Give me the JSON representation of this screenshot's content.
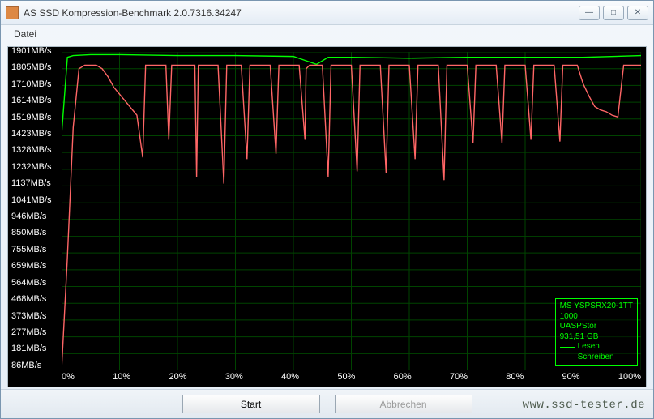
{
  "window": {
    "title": "AS SSD Kompression-Benchmark 2.0.7316.34247",
    "min_label": "—",
    "max_label": "□",
    "close_label": "✕"
  },
  "menu": {
    "file": "Datei"
  },
  "buttons": {
    "start": "Start",
    "abort": "Abbrechen"
  },
  "watermark": "www.ssd-tester.de",
  "device": {
    "line1": "MS YSPSRX20-1TT",
    "line2": "1000",
    "line3": "UASPStor",
    "line4": "931,51 GB"
  },
  "legend": {
    "read": "Lesen",
    "write": "Schreiben"
  },
  "chart_data": {
    "type": "line",
    "xlabel": "",
    "ylabel": "",
    "x_unit": "%",
    "y_unit": "MB/s",
    "xlim": [
      0,
      100
    ],
    "ylim": [
      86,
      1901
    ],
    "x_ticks": [
      0,
      10,
      20,
      30,
      40,
      50,
      60,
      70,
      80,
      90,
      100
    ],
    "x_tick_labels": [
      "0%",
      "10%",
      "20%",
      "30%",
      "40%",
      "50%",
      "60%",
      "70%",
      "80%",
      "90%",
      "100%"
    ],
    "y_ticks": [
      1901,
      1805,
      1710,
      1614,
      1519,
      1423,
      1328,
      1232,
      1137,
      1041,
      946,
      850,
      755,
      659,
      564,
      468,
      373,
      277,
      181,
      86
    ],
    "y_tick_labels": [
      "1901MB/s",
      "1805MB/s",
      "1710MB/s",
      "1614MB/s",
      "1519MB/s",
      "1423MB/s",
      "1328MB/s",
      "1232MB/s",
      "1137MB/s",
      "1041MB/s",
      "946MB/s",
      "850MB/s",
      "755MB/s",
      "659MB/s",
      "564MB/s",
      "468MB/s",
      "373MB/s",
      "277MB/s",
      "181MB/s",
      "86MB/s"
    ],
    "series": [
      {
        "name": "Lesen",
        "color": "#00ff00",
        "x": [
          0,
          1,
          2,
          5,
          10,
          20,
          30,
          40,
          44,
          46,
          50,
          60,
          70,
          80,
          90,
          100
        ],
        "y": [
          1430,
          1870,
          1880,
          1885,
          1885,
          1880,
          1880,
          1875,
          1830,
          1870,
          1870,
          1865,
          1870,
          1870,
          1870,
          1880
        ]
      },
      {
        "name": "Schreiben",
        "color": "#ff6666",
        "x": [
          0,
          1,
          2,
          3,
          4,
          5,
          6,
          7,
          8,
          9,
          10,
          11,
          12,
          13,
          14,
          14.5,
          15,
          16,
          17,
          18,
          18.5,
          19,
          20,
          21,
          22,
          23,
          23.3,
          23.6,
          24,
          25,
          26,
          27,
          28,
          28.5,
          29,
          30,
          31,
          32,
          32.5,
          33,
          34,
          35,
          36,
          37,
          37.5,
          38,
          39,
          40,
          41,
          42,
          42.2,
          42.8,
          43,
          44,
          45,
          46,
          46.5,
          47,
          48,
          49,
          50,
          51,
          51.5,
          52,
          53,
          54,
          55,
          56,
          56.5,
          57,
          58,
          59,
          60,
          61,
          61.5,
          62,
          63,
          64,
          65,
          66,
          66.5,
          67,
          68,
          69,
          70,
          71,
          71.5,
          72,
          73,
          74,
          75,
          76,
          76.5,
          77,
          78,
          79,
          80,
          81,
          81.5,
          82,
          83,
          84,
          85,
          86,
          86.5,
          87,
          88,
          89,
          90,
          91,
          92,
          93,
          94,
          95,
          96,
          97,
          98,
          99,
          100
        ],
        "y": [
          90,
          730,
          1470,
          1805,
          1825,
          1825,
          1825,
          1805,
          1760,
          1700,
          1660,
          1620,
          1580,
          1540,
          1300,
          1825,
          1825,
          1825,
          1825,
          1825,
          1400,
          1825,
          1825,
          1825,
          1825,
          1825,
          1190,
          1825,
          1825,
          1825,
          1825,
          1825,
          1150,
          1825,
          1825,
          1825,
          1825,
          1290,
          1825,
          1825,
          1825,
          1825,
          1825,
          1320,
          1825,
          1825,
          1825,
          1825,
          1825,
          1400,
          1805,
          1825,
          1825,
          1825,
          1825,
          1190,
          1825,
          1825,
          1825,
          1825,
          1825,
          1220,
          1825,
          1825,
          1825,
          1825,
          1825,
          1210,
          1825,
          1825,
          1825,
          1825,
          1825,
          1290,
          1825,
          1825,
          1825,
          1825,
          1825,
          1170,
          1825,
          1825,
          1825,
          1825,
          1825,
          1380,
          1825,
          1825,
          1825,
          1825,
          1825,
          1380,
          1825,
          1825,
          1825,
          1825,
          1825,
          1400,
          1825,
          1825,
          1825,
          1825,
          1825,
          1390,
          1825,
          1825,
          1825,
          1825,
          1720,
          1650,
          1590,
          1570,
          1560,
          1540,
          1530,
          1825,
          1825,
          1825,
          1825
        ]
      }
    ]
  }
}
